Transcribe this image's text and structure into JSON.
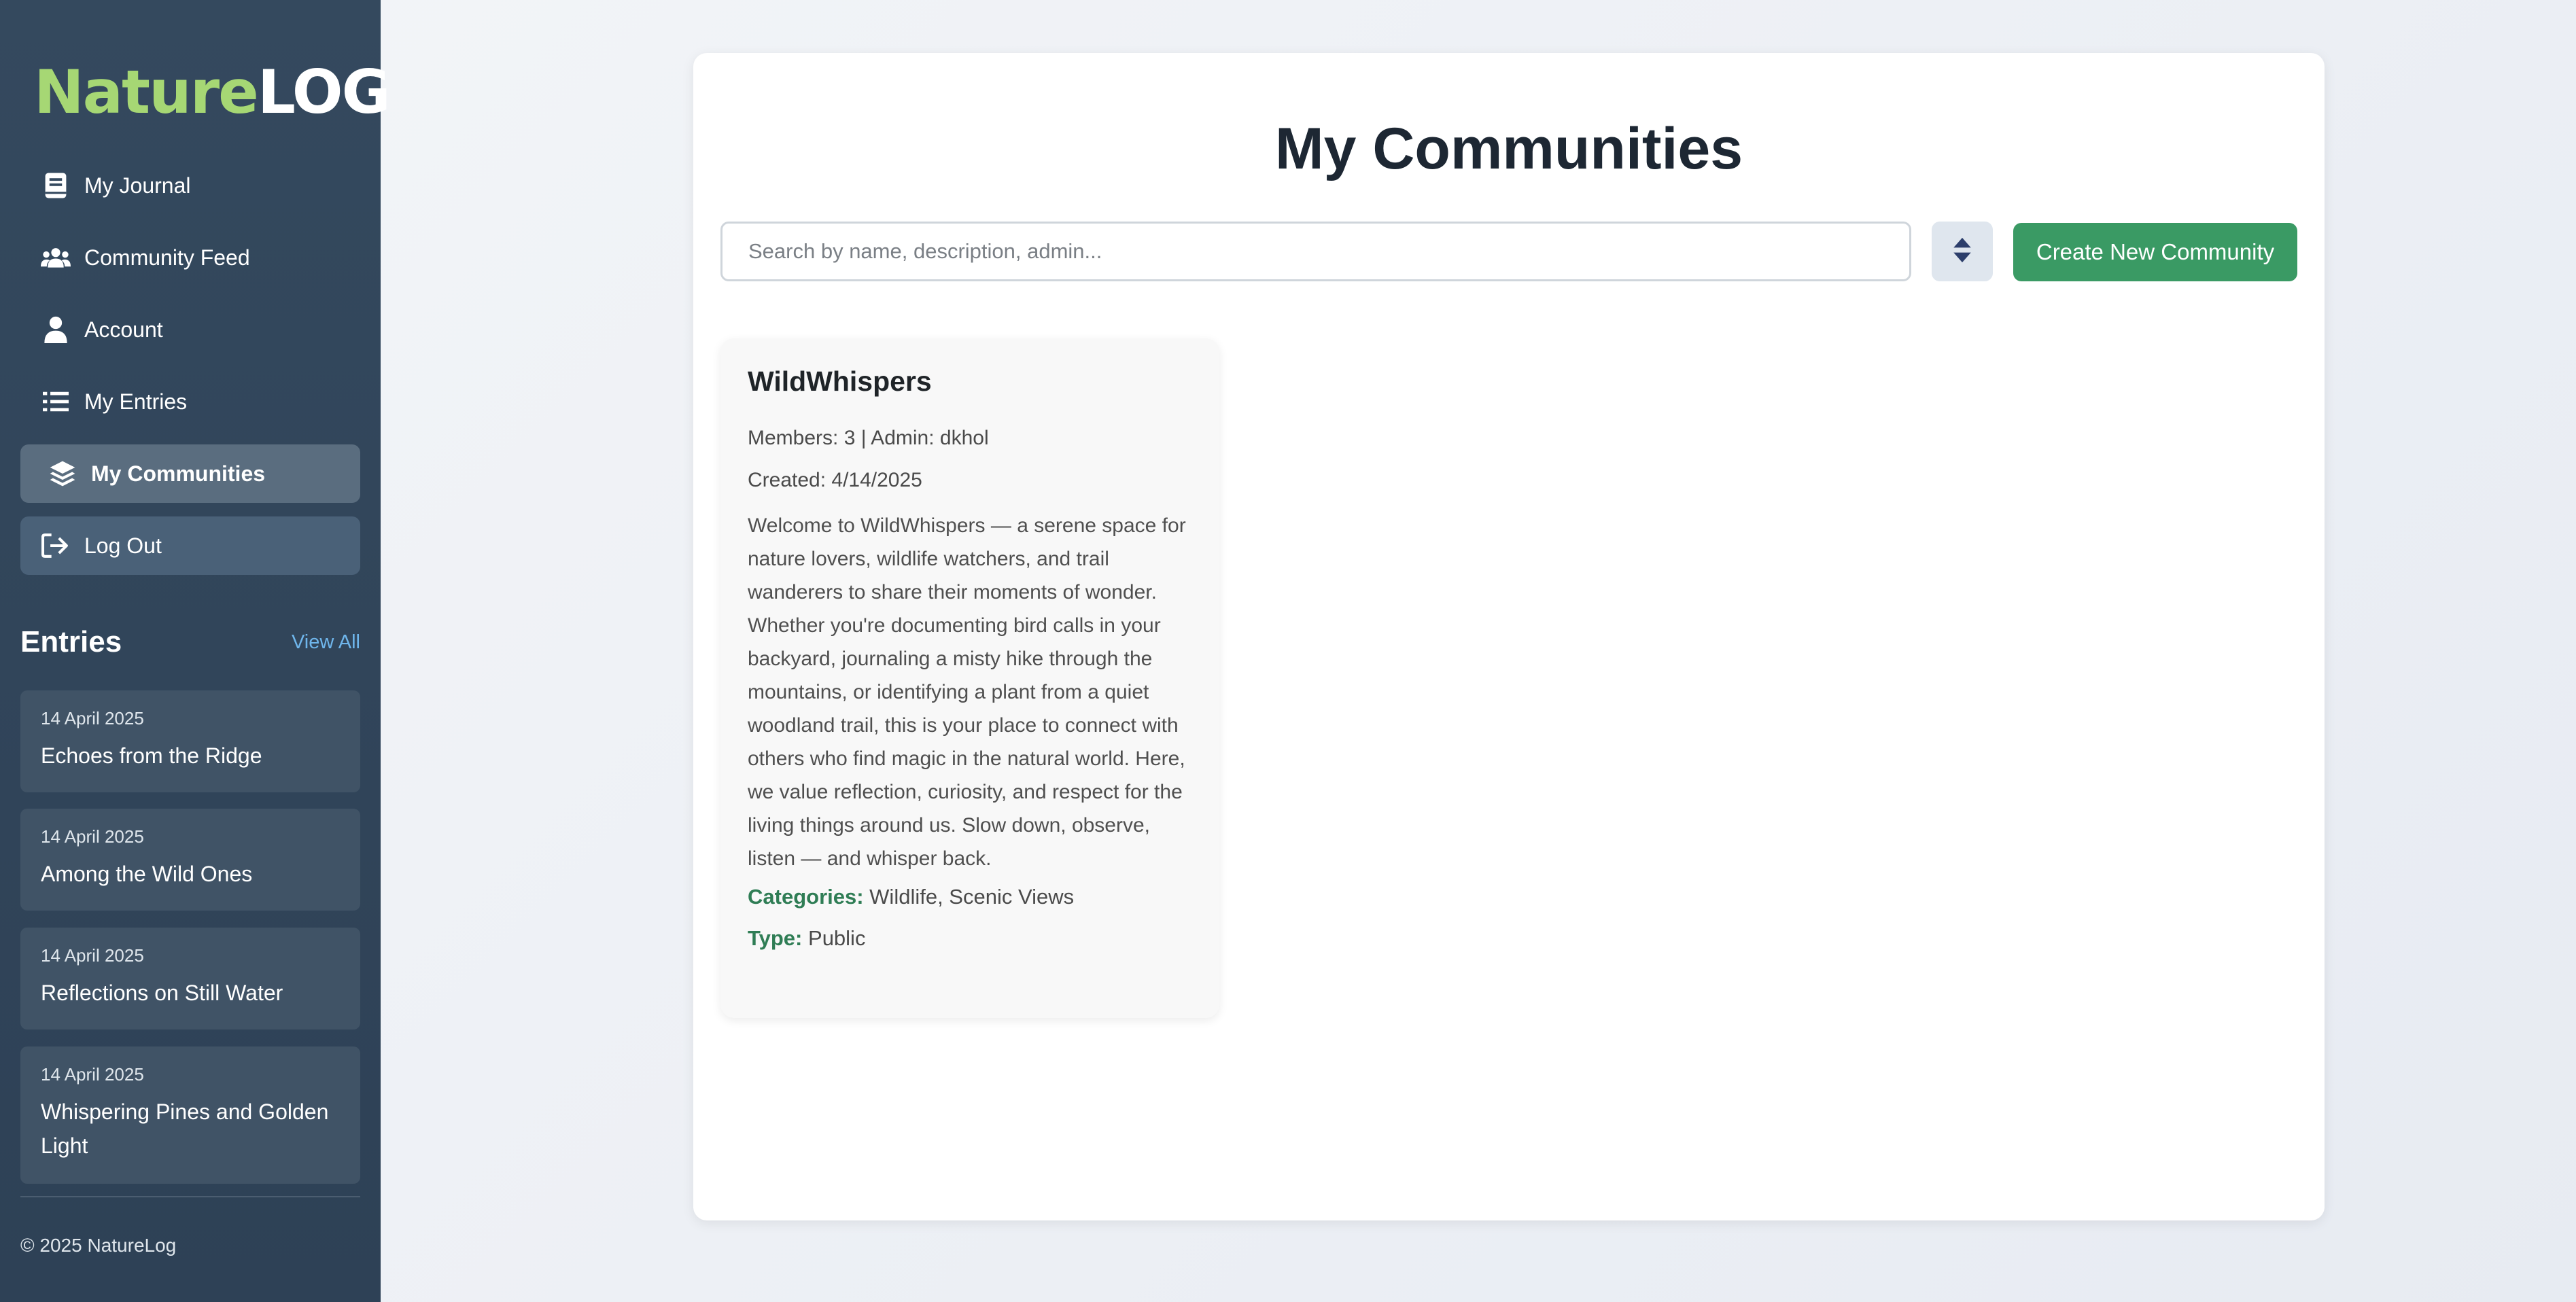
{
  "sidebar": {
    "logo": {
      "part1": "Nature",
      "part2": "LOG"
    },
    "nav": [
      {
        "label": "My Journal",
        "icon": "journal-icon"
      },
      {
        "label": "Community Feed",
        "icon": "users-icon"
      },
      {
        "label": "Account",
        "icon": "user-icon"
      },
      {
        "label": "My Entries",
        "icon": "list-icon"
      },
      {
        "label": "My Communities",
        "icon": "layers-icon",
        "active": true
      },
      {
        "label": "Log Out",
        "icon": "logout-icon"
      }
    ],
    "entries_title": "Entries",
    "view_all": "View All",
    "entries": [
      {
        "date": "14 April 2025",
        "title": "Echoes from the Ridge"
      },
      {
        "date": "14 April 2025",
        "title": "Among the Wild Ones"
      },
      {
        "date": "14 April 2025",
        "title": "Reflections on Still Water"
      },
      {
        "date": "14 April 2025",
        "title": "Whispering Pines and Golden Light"
      }
    ],
    "copyright": "© 2025 NatureLog"
  },
  "main": {
    "title": "My Communities",
    "search_placeholder": "Search by name, description, admin...",
    "create_button": "Create New Community",
    "communities": [
      {
        "name": "WildWhispers",
        "members_admin": "Members: 3 | Admin: dkhol",
        "created": "Created: 4/14/2025",
        "description": "Welcome to WildWhispers — a serene space for nature lovers, wildlife watchers, and trail wanderers to share their moments of wonder. Whether you're documenting bird calls in your backyard, journaling a misty hike through the mountains, or identifying a plant from a quiet woodland trail, this is your place to connect with others who find magic in the natural world. Here, we value reflection, curiosity, and respect for the living things around us. Slow down, observe, listen — and whisper back.",
        "categories_label": "Categories:",
        "categories": "Wildlife, Scenic Views",
        "type_label": "Type:",
        "type": "Public"
      }
    ]
  },
  "colors": {
    "sidebar_bg": "#34495e",
    "logo_accent": "#a6d774",
    "primary_button": "#3a9a64",
    "label_green": "#2f7d55",
    "link_blue": "#6fb6ec"
  }
}
